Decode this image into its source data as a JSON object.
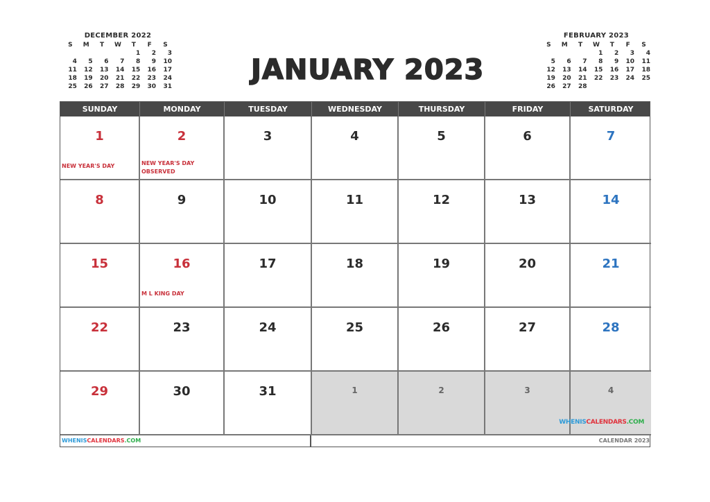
{
  "title": "JANUARY 2023",
  "weekdays": [
    "SUNDAY",
    "MONDAY",
    "TUESDAY",
    "WEDNESDAY",
    "THURSDAY",
    "FRIDAY",
    "SATURDAY"
  ],
  "mini_prev": {
    "title": "DECEMBER 2022",
    "head": [
      "S",
      "M",
      "T",
      "W",
      "T",
      "F",
      "S"
    ],
    "weeks": [
      [
        "",
        "",
        "",
        "",
        "1",
        "2",
        "3"
      ],
      [
        "4",
        "5",
        "6",
        "7",
        "8",
        "9",
        "10"
      ],
      [
        "11",
        "12",
        "13",
        "14",
        "15",
        "16",
        "17"
      ],
      [
        "18",
        "19",
        "20",
        "21",
        "22",
        "23",
        "24"
      ],
      [
        "25",
        "26",
        "27",
        "28",
        "29",
        "30",
        "31"
      ]
    ]
  },
  "mini_next": {
    "title": "FEBRUARY 2023",
    "head": [
      "S",
      "M",
      "T",
      "W",
      "T",
      "F",
      "S"
    ],
    "weeks": [
      [
        "",
        "",
        "",
        "1",
        "2",
        "3",
        "4"
      ],
      [
        "5",
        "6",
        "7",
        "8",
        "9",
        "10",
        "11"
      ],
      [
        "12",
        "13",
        "14",
        "15",
        "16",
        "17",
        "18"
      ],
      [
        "19",
        "20",
        "21",
        "22",
        "23",
        "24",
        "25"
      ],
      [
        "26",
        "27",
        "28",
        "",
        "",
        "",
        ""
      ]
    ]
  },
  "days": [
    {
      "n": "1",
      "type": "sun",
      "holiday": [
        "NEW YEAR'S DAY"
      ]
    },
    {
      "n": "2",
      "type": "hol",
      "holiday": [
        "NEW YEAR'S DAY",
        "OBSERVED"
      ]
    },
    {
      "n": "3"
    },
    {
      "n": "4"
    },
    {
      "n": "5"
    },
    {
      "n": "6"
    },
    {
      "n": "7",
      "type": "sat"
    },
    {
      "n": "8",
      "type": "sun"
    },
    {
      "n": "9"
    },
    {
      "n": "10"
    },
    {
      "n": "11"
    },
    {
      "n": "12"
    },
    {
      "n": "13"
    },
    {
      "n": "14",
      "type": "sat"
    },
    {
      "n": "15",
      "type": "sun"
    },
    {
      "n": "16",
      "type": "hol",
      "holiday": [
        "M L KING DAY"
      ]
    },
    {
      "n": "17"
    },
    {
      "n": "18"
    },
    {
      "n": "19"
    },
    {
      "n": "20"
    },
    {
      "n": "21",
      "type": "sat"
    },
    {
      "n": "22",
      "type": "sun"
    },
    {
      "n": "23"
    },
    {
      "n": "24"
    },
    {
      "n": "25"
    },
    {
      "n": "26"
    },
    {
      "n": "27"
    },
    {
      "n": "28",
      "type": "sat"
    },
    {
      "n": "29",
      "type": "sun"
    },
    {
      "n": "30"
    },
    {
      "n": "31"
    },
    {
      "n": "1",
      "type": "next"
    },
    {
      "n": "2",
      "type": "next"
    },
    {
      "n": "3",
      "type": "next"
    },
    {
      "n": "4",
      "type": "next",
      "logo": true
    }
  ],
  "brand": {
    "a": "WHENIS",
    "b": "CALENDARS",
    ".c": "",
    "c": ".COM"
  },
  "footer_right": "CALENDAR 2023",
  "colors": {
    "sunday": "#c8303a",
    "saturday": "#2d74c0",
    "header_bg": "#484848",
    "next_bg": "#d9d9d9"
  }
}
